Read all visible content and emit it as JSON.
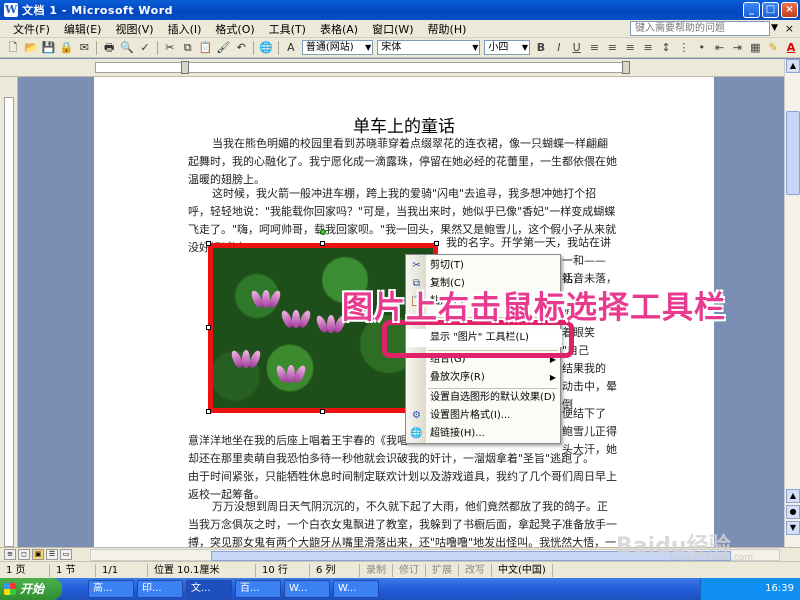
{
  "window": {
    "title": "文档 1 - Microsoft Word",
    "minimize": "_",
    "maximize": "□",
    "close": "×"
  },
  "menubar": {
    "items": [
      "文件(F)",
      "编辑(E)",
      "视图(V)",
      "插入(I)",
      "格式(O)",
      "工具(T)",
      "表格(A)",
      "窗口(W)",
      "帮助(H)"
    ],
    "help_placeholder": "键入需要帮助的问题",
    "close_doc": "×"
  },
  "toolbar": {
    "style_value": "普通(网站)",
    "font_value": "宋体",
    "size_value": "小四",
    "bold": "B",
    "italic": "I",
    "underline": "U",
    "font_color_letter": "A"
  },
  "document": {
    "title": "单车上的童话",
    "paragraphs": [
      "当我在熊色明媚的校园里看到苏晓菲穿着点缀翠花的连衣裙，像一只蝴蝶一样翩翩起舞时，我的心融化了。我宁愿化成一滴露珠，停留在她必经的花蕾里，一生都依偎在她温暖的翅膀上。",
      "这时候，我火箭一般冲进车棚，跨上我的爱骑\"闪电\"去追寻，我多想冲她打个招呼，轻轻地说：\"我能载你回家吗？\"可是，当我出来时，她似乎已像\"香妃\"一样变成蝴蝶飞走了。\"嗨，呵呵帅哥，载我回家呗。\"我一回头，果然又是鲍雪儿，这个假小子从来就没好好喊过",
      "我的名字。开学第一天，我站在讲台",
      "意洋洋地坐在我的后座上唱着王宇春的《我唱",
      "却还在那里卖萌自我恐怕多待一秒他就会识破我的奸计，一溜烟拿着\"圣旨\"逃跑了。",
      "由于时间紧张，只能牺牲休息时间制定联欢计划以及游戏道具，我约了几个哥们周日早上返校一起筹备。",
      "万万没想到周日天气阴沉沉的，不久就下起了大雨，他们竟然都放了我的鸽子。正当我万念俱灰之时，一个白衣女鬼飘进了教室，我躲到了书橱后面，拿起凳子准备放手一搏，突见那女鬼有两个大龅牙从嘴里滑落出来，还\"咕噜噜\"地发出怪叫。我恍然大悟，一个翻身"
    ],
    "right_fragments": [
      "一和——礼，",
      "话音未落，",
      "眼睛笑",
      "着眼笑",
      "\"自己",
      "结果我的",
      "动击中，晕倒",
      "便结下了",
      "鲍雪儿正得",
      "头大汗，她"
    ]
  },
  "context_menu": {
    "items": [
      {
        "label": "剪切(T)",
        "icon": "✂"
      },
      {
        "label": "复制(C)",
        "icon": "⧉"
      },
      {
        "label": "粘贴(P)",
        "icon": "📋"
      },
      {
        "label": "显示 \"图片\" 工具栏(L)",
        "icon": ""
      },
      {
        "label": "组合(G)",
        "icon": "",
        "submenu": "▶"
      },
      {
        "label": "叠放次序(R)",
        "icon": "",
        "submenu": "▶"
      },
      {
        "label": "设置自选图形的默认效果(D)",
        "icon": ""
      },
      {
        "label": "设置图片格式(I)...",
        "icon": "⚙"
      },
      {
        "label": "超链接(H)...",
        "icon": "🌐"
      }
    ]
  },
  "annotation_text": "图片上右击鼠标选择工具栏",
  "statusbar": {
    "page": "1 页",
    "section": "1 节",
    "page_of": "1/1",
    "position": "位置 10.1厘米",
    "line": "10 行",
    "column": "6 列",
    "rec": "录制",
    "trk": "修订",
    "ext": "扩展",
    "ovr": "改写",
    "language": "中文(中国)"
  },
  "taskbar": {
    "start_label": "开始",
    "tasks": [
      "高...",
      "印...",
      "文...",
      "百...",
      "W...",
      "W..."
    ],
    "clock": "16:39"
  },
  "watermark": {
    "logo": "Baidu经验",
    "sub": "jingyan.baidu.com"
  }
}
